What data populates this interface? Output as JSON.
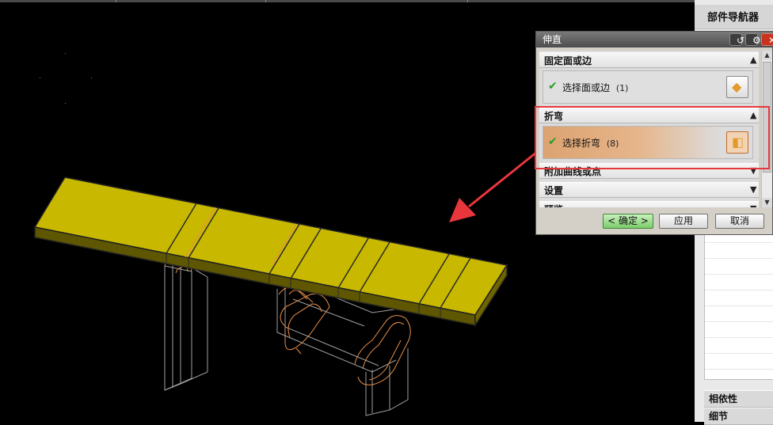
{
  "window": {
    "title": "伸直"
  },
  "dialog": {
    "sections": [
      {
        "title": "固定面或边",
        "row_label": "选择面或边",
        "row_count": "(1)",
        "expanded": true,
        "active": false
      },
      {
        "title": "折弯",
        "row_label": "选择折弯",
        "row_count": "(8)",
        "expanded": true,
        "active": true
      },
      {
        "title": "附加曲线或点",
        "expanded": false
      },
      {
        "title": "设置",
        "expanded": false
      },
      {
        "title": "预览",
        "expanded": false
      }
    ],
    "buttons": {
      "ok": "< 确定 >",
      "apply": "应用",
      "cancel": "取消"
    }
  },
  "navigator": {
    "title": "部件导航器",
    "panels": [
      "相依性",
      "细节"
    ]
  },
  "icons": {
    "check": "check-icon",
    "cube": "cube-select-icon",
    "collapse": "chevron-up-icon",
    "expand": "chevron-down-icon",
    "reset": "reset-icon",
    "settings": "gear-icon",
    "close": "close-icon"
  },
  "colors": {
    "viewport_bg": "#000000",
    "part_face": "#c8b800",
    "bend_line": "#e8904a",
    "highlight": "#e8373c",
    "check": "#2a9d2a"
  }
}
